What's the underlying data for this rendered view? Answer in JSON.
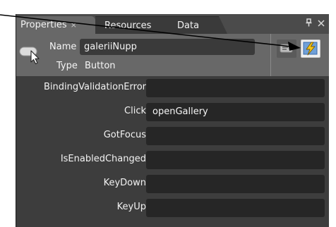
{
  "tabs": {
    "properties": "Properties",
    "properties_close": "×",
    "resources": "Resources",
    "data": "Data"
  },
  "header": {
    "name_label": "Name",
    "name_value": "galeriiNupp",
    "type_label": "Type",
    "type_value": "Button"
  },
  "events": [
    {
      "label": "BindingValidationError",
      "value": ""
    },
    {
      "label": "Click",
      "value": "openGallery"
    },
    {
      "label": "GotFocus",
      "value": ""
    },
    {
      "label": "IsEnabledChanged",
      "value": ""
    },
    {
      "label": "KeyDown",
      "value": ""
    },
    {
      "label": "KeyUp",
      "value": ""
    }
  ],
  "colors": {
    "panel": "#3d3d3d",
    "header": "#686868",
    "field": "#262626",
    "events_icon": "#f5c518"
  },
  "icons": {
    "element": "button-element-icon",
    "pin": "pin-icon",
    "close": "close-icon",
    "properties_view": "properties-view-icon",
    "events_view": "events-lightning-icon"
  }
}
